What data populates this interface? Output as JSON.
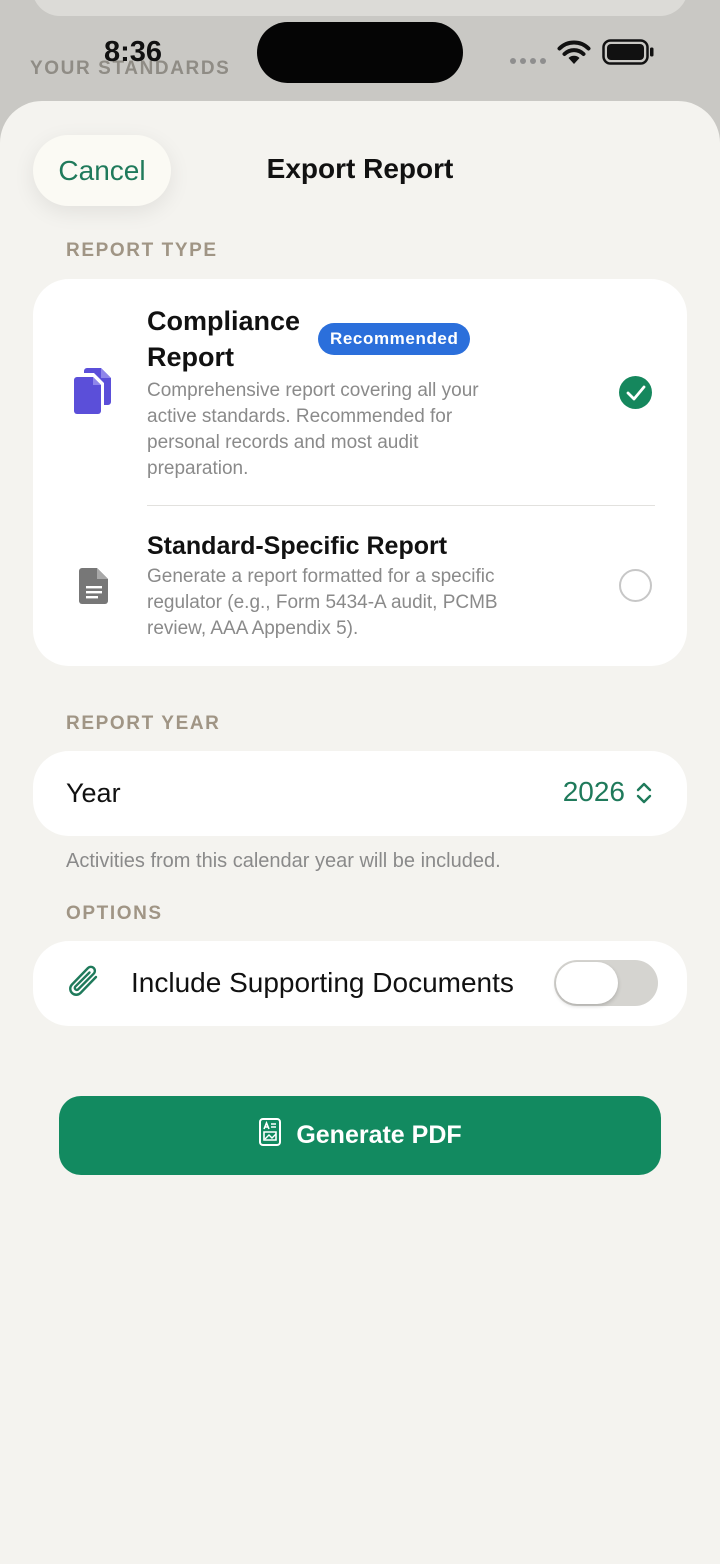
{
  "status_bar": {
    "time": "8:36"
  },
  "background": {
    "section_label": "YOUR STANDARDS"
  },
  "header": {
    "cancel_label": "Cancel",
    "title": "Export Report"
  },
  "report_type": {
    "section_label": "REPORT TYPE",
    "options": [
      {
        "title_line1": "Compliance",
        "title_line2": "Report",
        "badge": "Recommended",
        "description_lines": [
          "Comprehensive report covering all your",
          "active standards. Recommended for",
          "personal records and most audit",
          "preparation."
        ],
        "selected": true,
        "icon": "documents-icon"
      },
      {
        "title": "Standard-Specific Report",
        "description_lines": [
          "Generate a report formatted for a specific",
          "regulator (e.g., Form 5434-A audit, PCMB",
          "review, AAA Appendix 5)."
        ],
        "selected": false,
        "icon": "document-icon"
      }
    ]
  },
  "report_year": {
    "section_label": "REPORT YEAR",
    "label": "Year",
    "value": "2026",
    "footnote": "Activities from this calendar year will be included."
  },
  "options": {
    "section_label": "OPTIONS",
    "include_docs_label": "Include Supporting Documents",
    "include_docs_enabled": false,
    "icon": "paperclip-icon"
  },
  "generate": {
    "label": "Generate PDF",
    "icon": "pdf-document-icon"
  },
  "colors": {
    "accent": "#1f7a5b",
    "button": "#128a60",
    "badge": "#2b6fdb",
    "doc_icon": "#5b4fd9"
  }
}
